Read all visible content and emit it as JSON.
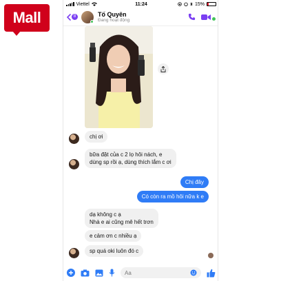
{
  "brand": {
    "badge": "Mall"
  },
  "status_bar": {
    "carrier": "Viettel",
    "time": "11:24",
    "battery": "15%"
  },
  "header": {
    "back_count": "8",
    "contact_name": "Tố Quyên",
    "activity": "Đang hoạt động"
  },
  "messages": [
    {
      "from": "contact",
      "text": "chị ơi"
    },
    {
      "from": "contact",
      "lines": [
        "bữa đặt của c 2 lọ hôi nách, e",
        "dùng sp rồi ạ, dùng thích lắm c ơi"
      ]
    },
    {
      "from": "me",
      "text": "Chị đây"
    },
    {
      "from": "me",
      "text": "Có còn ra mồ hôi nữa k e"
    },
    {
      "from": "contact",
      "lines": [
        "dạ không c ạ",
        "Nhà e ai cũng mê hết trơn"
      ]
    },
    {
      "from": "contact",
      "text": "e cảm ơn c nhiều ạ"
    },
    {
      "from": "contact",
      "text": "sp quá oki luôn đó c"
    }
  ],
  "composer": {
    "placeholder": "Aa"
  },
  "colors": {
    "accent": "#7b3ff2",
    "outgoing": "#2f7cf6",
    "incoming": "#f0f0f0",
    "mall": "#d0011b"
  }
}
